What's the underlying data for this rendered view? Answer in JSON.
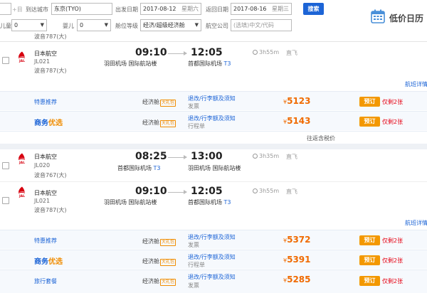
{
  "search": {
    "from_placeholder": "+目",
    "to_label": "到达城市",
    "to_value": "东京(TYO)",
    "depart_label": "出发日期",
    "depart_value": "2017-08-12",
    "depart_weekday": "星期六",
    "return_label": "返回日期",
    "return_value": "2017-08-16",
    "return_weekday": "星期三",
    "search_btn": "搜索",
    "child_label": "儿童",
    "child_value": "0",
    "infant_label": "婴儿",
    "infant_value": "0",
    "cabin_label": "舱位等级",
    "cabin_value": "经济/超级经济舱",
    "airline_label": "航空公司",
    "airline_placeholder": "(选填)中文/代码",
    "calendar_title": "低价日历"
  },
  "top_row": {
    "ptype": "波音787(大)"
  },
  "flights": [
    {
      "airline": "日本航空",
      "fno": "JL021",
      "ptype": "波音787(大)",
      "dep_time": "09:10",
      "arr_time": "12:05",
      "dep_airport": "羽田机场 国际航站楼",
      "arr_airport": "首都国际机场",
      "arr_term": "T3",
      "duration": "3h55m",
      "direct": "直飞",
      "link": "航班详情"
    },
    {
      "airline": "日本航空",
      "fno": "JL020",
      "ptype": "波音767(大)",
      "dep_time": "08:25",
      "arr_time": "13:00",
      "dep_airport": "首都国际机场",
      "dep_term": "T3",
      "arr_airport": "羽田机场 国际航站楼",
      "duration": "3h35m",
      "direct": "直飞"
    },
    {
      "airline": "日本航空",
      "fno": "JL021",
      "ptype": "波音787(大)",
      "dep_time": "09:10",
      "arr_time": "12:05",
      "dep_airport": "羽田机场 国际航站楼",
      "arr_airport": "首都国际机场",
      "arr_term": "T3",
      "duration": "3h55m",
      "direct": "直飞",
      "link": "航班详情"
    }
  ],
  "fares1": [
    {
      "name": "特惠推荐",
      "cls": "经济舱",
      "gift": "大礼包",
      "rule": "退改/行李额及须知",
      "rule2": "发票",
      "price": "5123",
      "cur": "¥",
      "book": "预订",
      "left": "仅剩2张"
    },
    {
      "name_a": "商务",
      "name_b": "优选",
      "cls": "经济舱",
      "gift": "大礼包",
      "rule": "退改/行李额及须知",
      "rule2": "行程单",
      "price": "5143",
      "cur": "¥",
      "book": "预订",
      "left": "仅剩2张"
    }
  ],
  "tax_note": "往返含税价",
  "fares2": [
    {
      "name": "特惠推荐",
      "cls": "经济舱",
      "gift": "大礼包",
      "rule": "退改/行李额及须知",
      "rule2": "发票",
      "price": "5372",
      "cur": "¥",
      "book": "预订",
      "left": "仅剩2张"
    },
    {
      "name_a": "商务",
      "name_b": "优选",
      "cls": "经济舱",
      "gift": "大礼包",
      "rule": "退改/行李额及须知",
      "rule2": "行程单",
      "price": "5391",
      "cur": "¥",
      "book": "预订",
      "left": "仅剩2张"
    },
    {
      "name": "旅行套餐",
      "cls": "经济舱",
      "gift": "大礼包",
      "rule": "退改/行李额及须知",
      "rule2": "发票",
      "price": "5285",
      "cur": "¥",
      "book": "预订",
      "left": "仅剩2张"
    }
  ],
  "colors": {
    "accent": "#1c64d6",
    "price": "#f06a00",
    "book": "#f39800",
    "jal_red": "#d7000f"
  }
}
